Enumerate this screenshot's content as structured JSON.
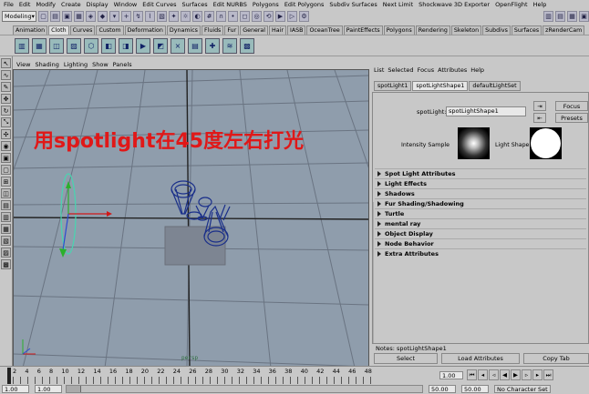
{
  "menu": [
    "File",
    "Edit",
    "Modify",
    "Create",
    "Display",
    "Window",
    "Edit Curves",
    "Surfaces",
    "Edit NURBS",
    "Polygons",
    "Edit Polygons",
    "Subdiv Surfaces",
    "Next Limit",
    "Shockwave 3D Exporter",
    "OpenFlight",
    "Help"
  ],
  "toolbar": {
    "mode": "Modeling"
  },
  "shelf_tabs": [
    "Animation",
    "Cloth",
    "Curves",
    "Custom",
    "Deformation",
    "Dynamics",
    "Fluids",
    "Fur",
    "General",
    "Hair",
    "IASB",
    "OceanTree",
    "PaintEffects",
    "Polygons",
    "Rendering",
    "Skeleton",
    "Subdivs",
    "Surfaces",
    "zRenderCam"
  ],
  "panel_menu": [
    "View",
    "Shading",
    "Lighting",
    "Show",
    "Panels"
  ],
  "viewport": {
    "annotation": "用spotlight在45度左右打光",
    "camera": "persp"
  },
  "attr_menu": [
    "List",
    "Selected",
    "Focus",
    "Attributes",
    "Help"
  ],
  "attr_tabs": [
    "spotLight1",
    "spotLightShape1",
    "defaultLightSet"
  ],
  "attr": {
    "node_label": "spotLight:",
    "node_value": "spotLightShape1",
    "focus": "Focus",
    "presets": "Presets",
    "intensity_sample": "Intensity Sample",
    "light_shape": "Light Shape",
    "sections": [
      "Spot Light Attributes",
      "Light Effects",
      "Shadows",
      "Fur Shading/Shadowing",
      "Turtle",
      "mental ray",
      "Object Display",
      "Node Behavior",
      "Extra Attributes"
    ],
    "notes": "Notes: spotLightShape1",
    "select": "Select",
    "load_attributes": "Load Attributes",
    "copy_tab": "Copy Tab"
  },
  "timeline": {
    "ticks": [
      "2",
      "4",
      "6",
      "8",
      "10",
      "12",
      "14",
      "16",
      "18",
      "20",
      "22",
      "24",
      "26",
      "28",
      "30",
      "32",
      "34",
      "36",
      "38",
      "40",
      "42",
      "44",
      "46",
      "48"
    ],
    "current": "1.00"
  },
  "range": {
    "start": "1.00",
    "start2": "1.00",
    "end": "50.00",
    "end2": "50.00",
    "charset": "No Character Set"
  },
  "colors": {
    "viewport_bg": "#8f9dac",
    "annotation": "#e01818",
    "light": "#1a2f8a"
  }
}
